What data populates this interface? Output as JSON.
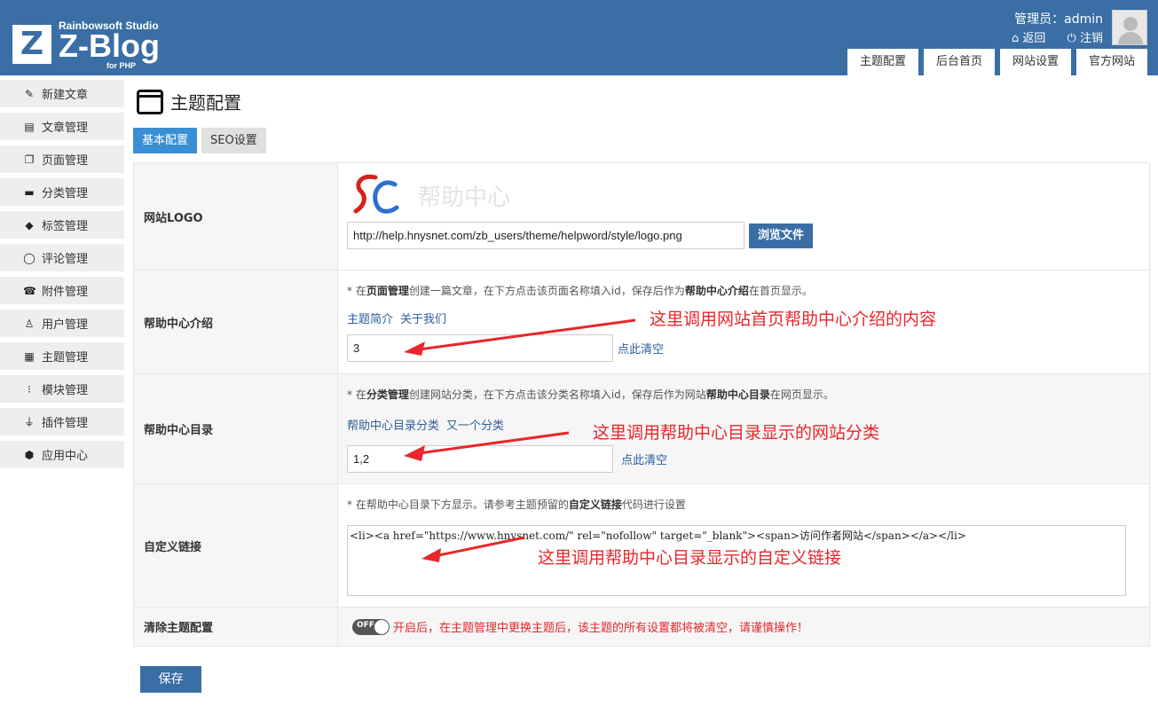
{
  "brand": {
    "studio": "Rainbowsoft Studio",
    "name": "Z-Blog",
    "sub": "for PHP",
    "letter": "Z"
  },
  "user": {
    "label": "管理员：admin",
    "back": "返回",
    "logout": "注销"
  },
  "topnav": [
    "主题配置",
    "后台首页",
    "网站设置",
    "官方网站"
  ],
  "sidebar": [
    {
      "label": "新建文章",
      "icon": "edit-icon"
    },
    {
      "label": "文章管理",
      "icon": "document-icon"
    },
    {
      "label": "页面管理",
      "icon": "pages-icon"
    },
    {
      "label": "分类管理",
      "icon": "folder-icon"
    },
    {
      "label": "标签管理",
      "icon": "tag-icon"
    },
    {
      "label": "评论管理",
      "icon": "comment-icon"
    },
    {
      "label": "附件管理",
      "icon": "attachment-icon"
    },
    {
      "label": "用户管理",
      "icon": "user-icon"
    },
    {
      "label": "主题管理",
      "icon": "theme-icon"
    },
    {
      "label": "模块管理",
      "icon": "module-icon"
    },
    {
      "label": "插件管理",
      "icon": "plugin-icon"
    },
    {
      "label": "应用中心",
      "icon": "box-icon"
    }
  ],
  "page": {
    "title": "主题配置"
  },
  "subtabs": [
    "基本配置",
    "SEO设置"
  ],
  "rows": {
    "logo": {
      "label": "网站LOGO",
      "logo_text": "帮助中心",
      "value": "http://help.hnysnet.com/zb_users/theme/helpword/style/logo.png",
      "browse": "浏览文件"
    },
    "intro": {
      "label": "帮助中心介绍",
      "hint_pre": "* 在",
      "hint_b1": "页面管理",
      "hint_mid": "创建一篇文章，在下方点击该页面名称填入id，保存后作为",
      "hint_b2": "帮助中心介绍",
      "hint_post": "在首页显示。",
      "links": [
        "主题简介",
        "关于我们"
      ],
      "value": "3",
      "clear": "点此清空",
      "annotation": "这里调用网站首页帮助中心介绍的内容"
    },
    "catalog": {
      "label": "帮助中心目录",
      "hint_pre": "* 在",
      "hint_b1": "分类管理",
      "hint_mid": "创建网站分类，在下方点击该分类名称填入id，保存后作为网站",
      "hint_b2": "帮助中心目录",
      "hint_post": "在网页显示。",
      "links": [
        "帮助中心目录分类",
        "又一个分类"
      ],
      "value": "1,2",
      "clear": "点此清空",
      "annotation": "这里调用帮助中心目录显示的网站分类"
    },
    "custom": {
      "label": "自定义链接",
      "hint_pre": "* 在帮助中心目录下方显示。请参考主题预留的",
      "hint_b1": "自定义链接",
      "hint_post": "代码进行设置",
      "value": "<li><a href=\"https://www.hnysnet.com/\" rel=\"nofollow\" target=\"_blank\"><span>访问作者网站</span></a></li>",
      "annotation": "这里调用帮助中心目录显示的自定义链接"
    },
    "reset": {
      "label": "清除主题配置",
      "toggle": "OFF",
      "warning": "开启后，在主题管理中更换主题后，该主题的所有设置都将被清空，请谨慎操作！"
    }
  },
  "save": "保存",
  "colors": {
    "header": "#3a6ea5",
    "active_tab": "#3a8fd4",
    "annotation": "#e8262b"
  }
}
